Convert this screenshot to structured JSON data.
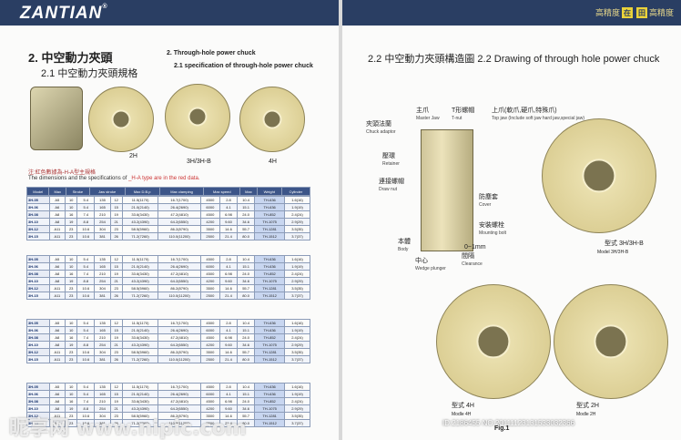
{
  "brand": {
    "logo": "ZANTIAN",
    "logo_mark": "®",
    "slogan": [
      "高精度",
      "在",
      "田",
      "高精度"
    ]
  },
  "left": {
    "section_title": "2. 中空動力夾頭",
    "section_sub": "2.1 中空動力夾頭規格",
    "en_title": "2. Through-hole power chuck",
    "en_sub": "2.1 specification of through-hole power chuck",
    "captions": [
      "3H/3H-B",
      "2H",
      "4H"
    ],
    "table_intro_cn": "注:紅色數據為-H-A型主規格",
    "table_intro_en": "The dimensions and the specifications of",
    "table_intro_red": "_H-A type are in the red data.",
    "table_headers": [
      "Model",
      "Max",
      "Stroke",
      "Jaw stroke",
      "Max D.B.p",
      "Max clamping",
      "Max speed",
      "Max",
      "Weight",
      "Cylinder"
    ],
    "rows": [
      [
        "3H-05",
        "A5",
        "10",
        "5.4",
        "135",
        "12",
        "11.5(1170)",
        "16.7(1700)",
        "4500",
        "2.8",
        "10.4",
        "TH-636",
        "1.6(16)"
      ],
      [
        "3H-06",
        "A6",
        "10",
        "5.4",
        "165",
        "15",
        "21.0(2140)",
        "26.4(2690)",
        "6000",
        "4.1",
        "15.1",
        "TH-636",
        "1.9(19)"
      ],
      [
        "3H-08",
        "A8",
        "16",
        "7.4",
        "210",
        "19",
        "33.6(3430)",
        "47.2(4810)",
        "4500",
        "6.98",
        "24.0",
        "TH-852",
        "2.4(24)"
      ],
      [
        "3H-10",
        "A8",
        "19",
        "8.8",
        "254",
        "21",
        "43.2(4390)",
        "64.2(6550)",
        "4200",
        "9.60",
        "34.6",
        "TH-1075",
        "2.9(29)"
      ],
      [
        "3H-12",
        "A11",
        "23",
        "10.6",
        "304",
        "23",
        "58.5(5960)",
        "86.2(8790)",
        "3500",
        "14.6",
        "55.7",
        "TH-1281",
        "3.5(35)"
      ],
      [
        "3H-15",
        "A11",
        "23",
        "10.6",
        "381",
        "26",
        "71.2(7260)",
        "110.0(11200)",
        "2500",
        "21.4",
        "80.0",
        "TH-1512",
        "3.7(37)"
      ]
    ]
  },
  "right": {
    "fig_title_cn": "2.2 中空動力夾頭構造圖",
    "fig_title_en": "2.2 Drawing of through hole power chuck",
    "labels": [
      {
        "cn": "主爪",
        "en": "Master Jaw"
      },
      {
        "cn": "T形螺帽",
        "en": "T-nut"
      },
      {
        "cn": "上爪(軟爪,硬爪,特殊爪)",
        "en": "Top jaw (Include soft jaw hard jaw,special jaw)"
      },
      {
        "cn": "夾頭法蘭",
        "en": "Chuck adaptor"
      },
      {
        "cn": "壓環",
        "en": "Retainer"
      },
      {
        "cn": "連接螺帽",
        "en": "Draw nut"
      },
      {
        "cn": "防塵套",
        "en": "Cover"
      },
      {
        "cn": "安裝螺栓",
        "en": "Mounting bolt"
      },
      {
        "cn": "本體",
        "en": "Body"
      },
      {
        "cn": "中心",
        "en": "Wedge plunger"
      },
      {
        "cn": "間隔",
        "en": "Clearance"
      }
    ],
    "clearance_value": "0~1mm",
    "models": [
      "型式 3H/3H-B",
      "Model 3H/3H-B",
      "型式 4H",
      "Modle 4H",
      "型式 2H",
      "Modle 2H"
    ],
    "fig_label": "Fig.1"
  },
  "overlay": {
    "watermark": "昵享网 www.nipic.com",
    "stamp": "ID:2186455 NO:20111123131533032366"
  }
}
